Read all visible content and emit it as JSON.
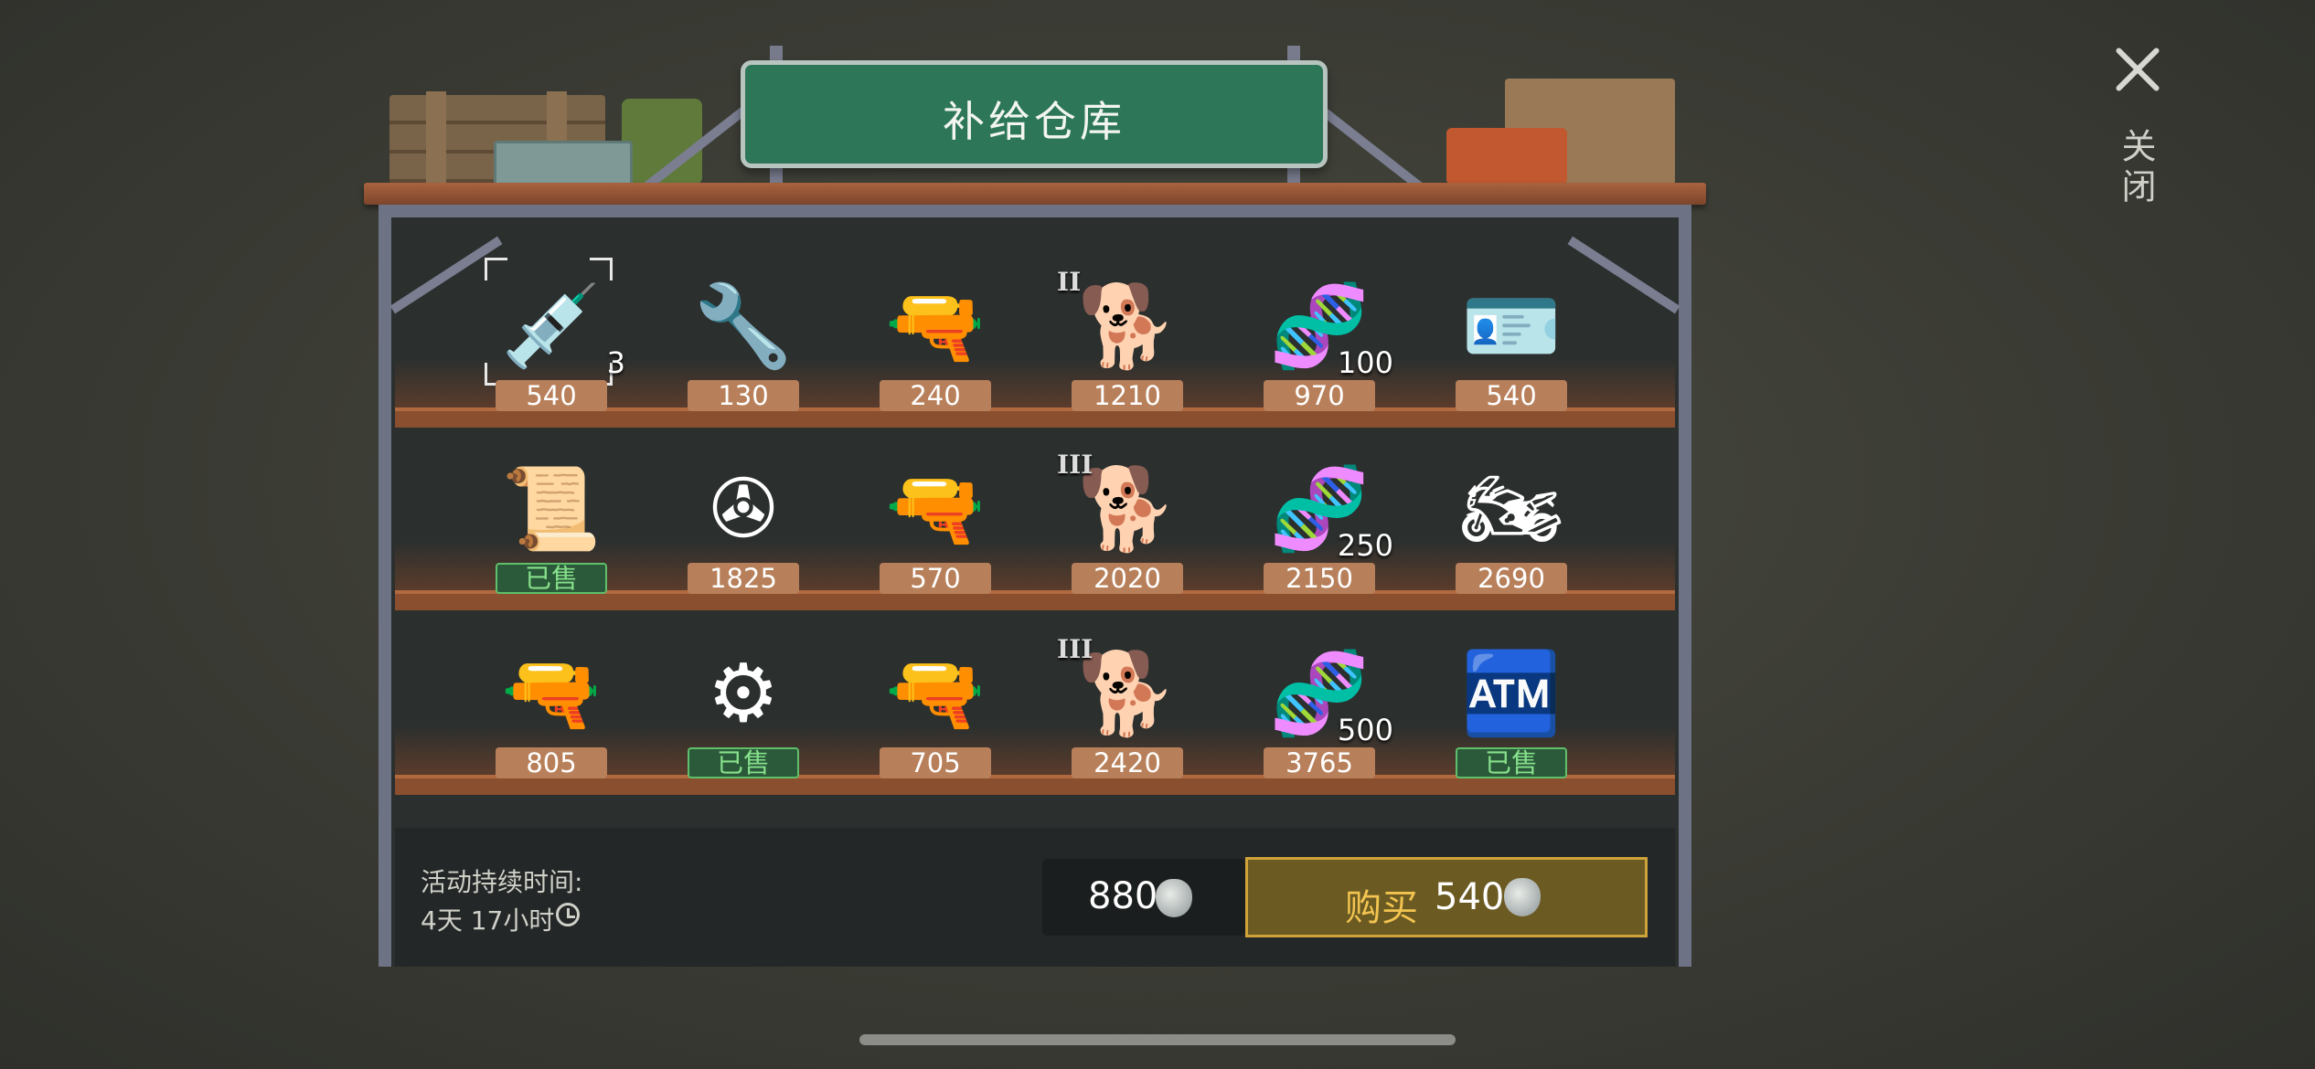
{
  "title": "补给仓库",
  "close": {
    "label": "关闭",
    "icon": "close-icon"
  },
  "shelves": [
    [
      {
        "icon": "syringe-gun-icon",
        "glyph": "💉",
        "price": "540",
        "qty": "3",
        "selected": true
      },
      {
        "icon": "motorcycle-handlebar-icon",
        "glyph": "🔧",
        "price": "130"
      },
      {
        "icon": "pistol-icon",
        "glyph": "🔫",
        "price": "240"
      },
      {
        "icon": "saint-bernard-dog-icon",
        "glyph": "🐕",
        "price": "1210",
        "tier": "II"
      },
      {
        "icon": "dna-capsule-icon",
        "glyph": "🧬",
        "price": "970",
        "qty": "100"
      },
      {
        "icon": "police-badge-wallet-icon",
        "glyph": "🪪",
        "price": "540"
      }
    ],
    [
      {
        "icon": "roll-blueprint-icon",
        "glyph": "📜",
        "price": "已售",
        "sold": true
      },
      {
        "icon": "propeller-icon",
        "glyph": "✇",
        "price": "1825"
      },
      {
        "icon": "rifle-icon",
        "glyph": "🔫",
        "price": "570"
      },
      {
        "icon": "rottweiler-dog-icon",
        "glyph": "🐕",
        "price": "2020",
        "tier": "III"
      },
      {
        "icon": "dna-capsule-icon",
        "glyph": "🧬",
        "price": "2150",
        "qty": "250"
      },
      {
        "icon": "chopper-motorcycle-icon",
        "glyph": "🏍",
        "price": "2690"
      }
    ],
    [
      {
        "icon": "grenade-launcher-icon",
        "glyph": "🔫",
        "price": "805"
      },
      {
        "icon": "engine-cart-icon",
        "glyph": "⚙",
        "price": "已售",
        "sold": true
      },
      {
        "icon": "sniper-rifle-icon",
        "glyph": "🔫",
        "price": "705"
      },
      {
        "icon": "saint-bernard-dog-icon",
        "glyph": "🐕",
        "price": "2420",
        "tier": "III"
      },
      {
        "icon": "dna-capsule-icon",
        "glyph": "🧬",
        "price": "3765",
        "qty": "500"
      },
      {
        "icon": "workbench-machine-icon",
        "glyph": "🏧",
        "price": "已售",
        "sold": true
      }
    ]
  ],
  "duration": {
    "label": "活动持续时间:",
    "value": "4天 17小时"
  },
  "balance": {
    "amount": "880",
    "icon": "mask-currency-icon"
  },
  "buy": {
    "label": "购买",
    "price": "540",
    "icon": "mask-currency-icon"
  },
  "colors": {
    "sign": "#2d7658",
    "price_tag": "#b8805a",
    "sold_border": "#5fbf6a",
    "buy_border": "#cfa33a",
    "buy_text": "#f2c450"
  }
}
